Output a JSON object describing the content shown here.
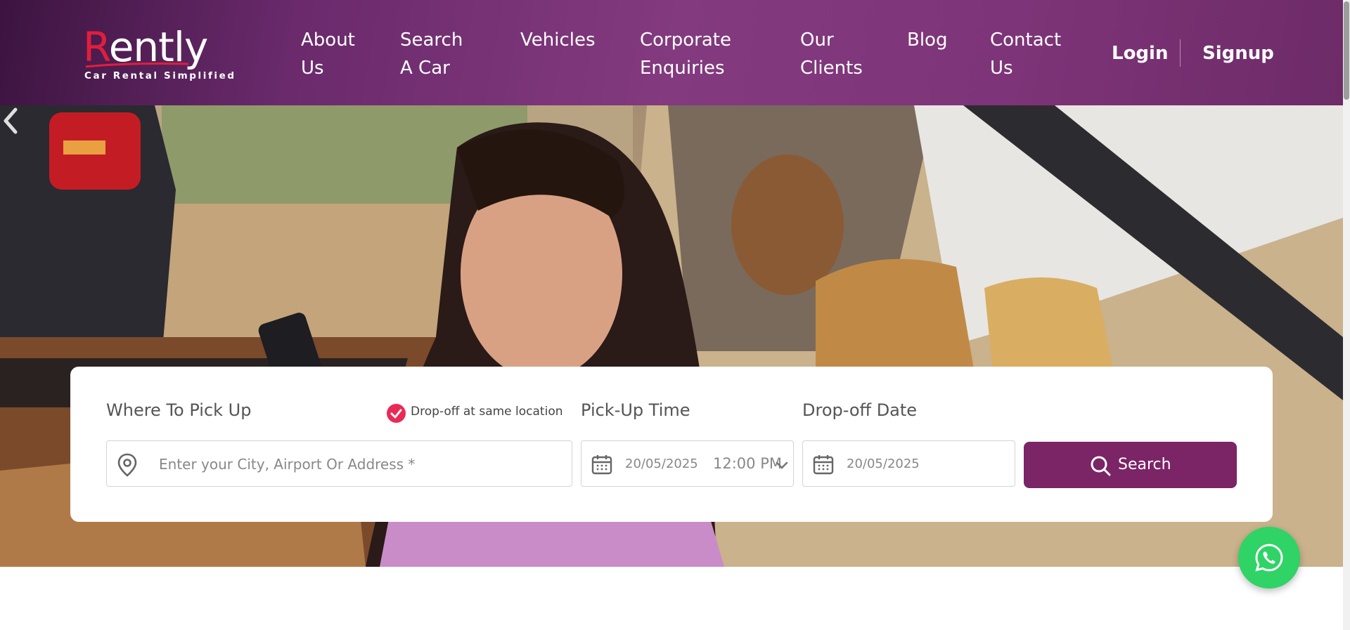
{
  "brand": {
    "name": "Rently",
    "name_first_letter": "R",
    "name_rest": "ently",
    "tagline": "Car Rental Simplified",
    "accent_color": "#e01e3c",
    "primary_color": "#7b2466"
  },
  "nav": {
    "items": [
      {
        "line1": "About",
        "line2": "Us"
      },
      {
        "line1": "Search",
        "line2": "A Car"
      },
      {
        "line1": "Vehicles",
        "line2": ""
      },
      {
        "line1": "Corporate",
        "line2": "Enquiries"
      },
      {
        "line1": "Our",
        "line2": "Clients"
      },
      {
        "line1": "Blog",
        "line2": ""
      },
      {
        "line1": "Contact",
        "line2": "Us"
      }
    ],
    "login": "Login",
    "signup": "Signup"
  },
  "hero": {
    "prev_icon": "chevron-left-icon"
  },
  "booking": {
    "pickup_label": "Where To Pick Up",
    "same_location_label": "Drop-off at same location",
    "same_location_checked": true,
    "pickup_placeholder": "Enter your City, Airport Or Address *",
    "pickup_time_label": "Pick-Up Time",
    "pickup_date": "20/05/2025",
    "pickup_time": "12:00 PM",
    "dropoff_label": "Drop-off Date",
    "dropoff_date": "20/05/2025",
    "search_label": "Search"
  },
  "icons": {
    "location": "map-pin-icon",
    "calendar": "calendar-icon",
    "search": "search-icon",
    "whatsapp": "whatsapp-icon",
    "check": "check-icon",
    "dropdown": "chevron-down-icon"
  }
}
